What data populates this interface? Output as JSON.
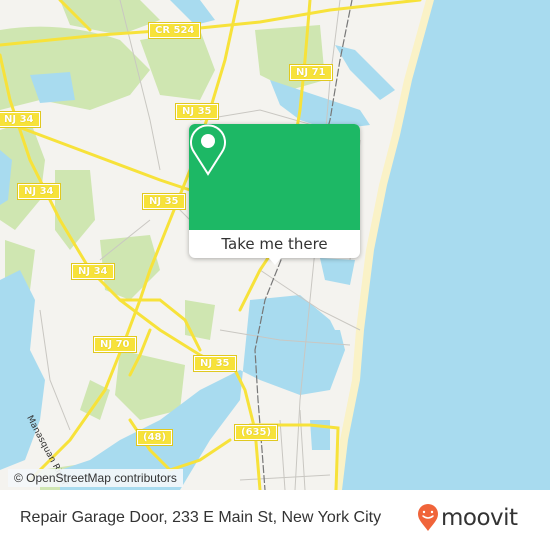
{
  "map": {
    "road_labels": [
      {
        "id": "cr524",
        "text": "CR 524"
      },
      {
        "id": "nj71",
        "text": "NJ 71"
      },
      {
        "id": "nj35-top",
        "text": "NJ 35"
      },
      {
        "id": "nj34-top",
        "text": "NJ 34"
      },
      {
        "id": "nj34-mid",
        "text": "NJ 34"
      },
      {
        "id": "nj35-mid",
        "text": "NJ 35"
      },
      {
        "id": "nj34-low",
        "text": "NJ 34"
      },
      {
        "id": "nj70",
        "text": "NJ 70"
      },
      {
        "id": "nj35-low",
        "text": "NJ 35"
      },
      {
        "id": "cr48",
        "text": "(48)"
      },
      {
        "id": "cr635",
        "text": "(635)"
      }
    ],
    "water_label": "Manasquan River",
    "attribution": "© OpenStreetMap contributors",
    "colors": {
      "land": "#f4f3ef",
      "water": "#a8dbef",
      "park": "#cfe6b1",
      "road": "#f7e23a",
      "beach": "#faf2c7"
    }
  },
  "popup": {
    "icon": "location-pin-icon",
    "button_label": "Take me there",
    "color": "#1db865"
  },
  "footer": {
    "title": "Repair Garage Door, 233 E Main St, New York City",
    "brand": "moovit",
    "brand_color": "#f0643a"
  }
}
